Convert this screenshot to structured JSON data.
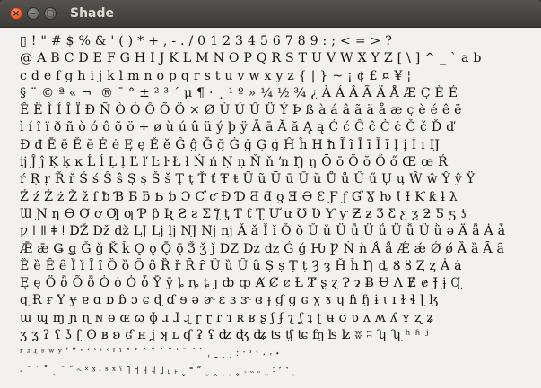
{
  "window": {
    "title": "Shade",
    "buttons": {
      "close": "×",
      "minimize": "–",
      "maximize": "□"
    }
  },
  "glyph_rows": [
    "▯     ! \" # $ % & ' ( ) * + , - . / 0 1 2 3 4 5 6 7 8 9 : ; < = > ?",
    "@ A B C D E F G H I J K L M N O P Q R S T U V W X Y Z [ \\ ] ^ _ ` a b",
    "c d e f g h i j k l m n o p q r s t u v w x y z { | } ~   ¡ ¢ £ ¤ ¥ ¦",
    "§ ¨ © ª « ¬ ­ ® ¯ ° ± ² ³ ´ µ ¶ · ¸ ¹ º » ¼ ½ ¾ ¿ À Á Â Ã Ä Å Æ Ç È É",
    "Ê Ë Ì Í Î Ï Ð Ñ Ò Ó Ô Õ Ö × Ø Ù Ú Û Ü Ý Þ ß à á â ã ä å æ ç è é ê ë",
    "ì í î ï ð ñ ò ó ô õ ö ÷ ø ù ú û ü ý þ ÿ Ā ā Ă ă Ą ą Ć ć Ĉ ĉ Ċ ċ Č č Ď ď",
    "Đ đ Ē ē Ĕ ĕ Ė ė Ę ę Ě ě Ĝ ĝ Ğ ğ Ġ ġ Ģ ģ Ĥ ĥ Ħ ħ Ĩ ĩ Ī ī Ĭ ĭ Į į İ ı Ĳ",
    "ĳ Ĵ ĵ Ķ ķ ĸ Ĺ ĺ Ļ ļ Ľ ľ Ŀ ŀ Ł ł Ń ń Ņ ņ Ň ň ŉ Ŋ ŋ Ō ō Ŏ ŏ Ő ő Œ œ Ŕ",
    "ŕ Ŗ ŗ Ř ř Ś ś Ŝ ŝ Ş ş Š š Ţ ţ Ť ť Ŧ ŧ Ũ ũ Ū ū Ŭ ŭ Ů ů Ű ű Ų ų Ŵ ŵ Ŷ ŷ Ÿ",
    "Ź ź Ż ż Ž ž ſ ƀ Ɓ Ƃ ƃ Ƅ ƅ Ɔ Ƈ ƈ Ɖ Ɗ Ƌ ƌ ƍ Ǝ Ə Ɛ Ƒ ƒ Ɠ Ɣ ƕ Ɩ Ɨ Ƙ ƙ ƚ ƛ",
    "Ɯ Ɲ ƞ Ɵ Ơ ơ Ƣ ƣ Ƥ ƥ Ʀ Ƨ ƨ Ʃ ƪ ƫ Ƭ ƭ Ʈ Ư ư Ʊ Ʋ Ƴ ƴ Ƶ ƶ Ʒ Ƹ ƹ ƺ ƻ Ƽ ƽ ƾ",
    "ƿ ǀ ǁ ǂ ǃ Ǆ ǅ ǆ Ǉ ǈ ǉ Ǌ ǋ ǌ Ǎ ǎ Ǐ ǐ Ǒ ǒ Ǔ ǔ Ǖ ǖ Ǘ ǘ Ǚ ǚ Ǜ ǜ ǝ Ǟ ǟ Ǡ ǡ",
    "Ǣ ǣ Ǥ ǥ Ǧ ǧ Ǩ ǩ Ǫ ǫ Ǭ ǭ Ǯ ǯ ǰ Ǳ ǲ ǳ Ǵ ǵ Ƕ Ƿ Ǹ ǹ Ǻ ǻ Ǽ ǽ Ǿ ǿ Ȁ ȁ Ȃ ȃ",
    "Ȅ ȅ Ȇ ȇ Ȉ ȉ Ȋ ȋ Ȍ ȍ Ȏ ȏ Ȑ ȑ Ȓ ȓ Ȕ ȕ Ȗ ȗ Ș ș Ț ț Ȝ ȝ Ȟ ȟ Ƞ ȡ Ȣ ȣ Ȥ ȥ Ȧ ȧ",
    "Ȩ ȩ Ȫ ȫ Ȭ ȭ Ȯ ȯ Ȱ ȱ Ȳ ȳ ȴ ȵ ȶ ȷ ȸ ȹ Ⱥ Ȼ ȼ Ƚ Ⱦ ȿ ɀ Ɂ ɂ Ƀ Ʉ Ʌ Ɇ ɇ Ɉ ɉ Ɋ",
    "ɋ Ɍ ɍ Ɏ ɏ ɐ ɑ ɒ ɓ ɔ ɕ ɖ ɗ ɘ ə ɚ ɛ ɜ ɝ ɞ ɟ ɠ ɡ ɢ ɣ ɤ ɥ ɦ ɧ ɨ ɩ ɪ ɫ ɬ ɭ ɮ",
    "ɯ ɰ ɱ ɲ ɳ ɴ ɵ ɶ ɷ ɸ ɹ ɺ ɻ ɼ ɽ ɾ ɿ ʀ ʁ ʂ ʃ ʄ ʅ ʆ ʇ ʈ ʉ ʊ ʋ ʌ ʍ ʎ ʏ ʐ ʑ",
    "ʒ ʓ ʔ ʕ ʖ ʗ ʘ ʙ ʚ ʛ ʜ ʝ ʞ ʟ ʠ ʡ ʢ ʣ ʤ ʥ ʦ ʧ ʨ ʩ ʪ ʫ ʬ ʭ ʮ ʯ ʰ ʱ ʲ",
    "ʳ ʴ ʵ ʶ ʷ ʸ ʹ ʺ ʻ ʼ ʽ ʾ ʿ ˀ ˁ ˂ ˃ ˄ ˅ ˆ ˇ ˈ ˉ ˊ ˋ ˌ ˍ ˎ ˏ ː ˑ ˒ ˓ ˔ ˕ ˖",
    "˗ ˘ ˙ ˚ ˛ ˜ ˝ ˞ ˟ ˠ ˡ ˢ ˣ ˤ ˥ ˦ ˧ ˨ ˩ ˪ ˫ ˬ ˭ ˮ ˯ ˰ ˱ ˲ ˳ ˴ ˵ ˶ ˷ ˸ ˹ ˺ ˻"
  ]
}
